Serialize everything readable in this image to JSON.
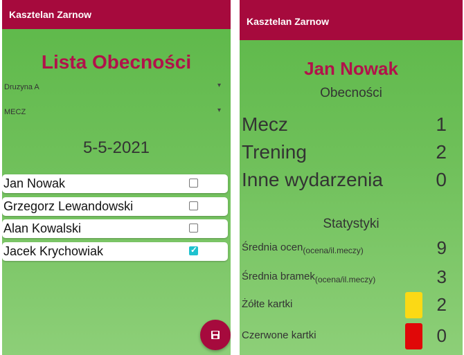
{
  "left_screen": {
    "app_title": "Kasztelan Zarnow",
    "page_title": "Lista Obecności",
    "team_dropdown": "Druzyna A",
    "event_dropdown": "MECZ",
    "date": "5-5-2021",
    "players": [
      {
        "name": "Jan  Nowak",
        "present": false
      },
      {
        "name": "Grzegorz Lewandowski",
        "present": false
      },
      {
        "name": "Alan Kowalski",
        "present": false
      },
      {
        "name": "Jacek Krychowiak",
        "present": true
      }
    ],
    "save_icon": "save-icon"
  },
  "right_screen": {
    "app_title": "Kasztelan Zarnow",
    "player_name": "Jan  Nowak",
    "attendance_heading": "Obecności",
    "attendance": [
      {
        "label": "Mecz",
        "value": "1"
      },
      {
        "label": "Trening",
        "value": "2"
      },
      {
        "label": "Inne wydarzenia",
        "value": "0"
      }
    ],
    "stats_heading": "Statystyki",
    "stats": [
      {
        "label": "Średnia ocen",
        "sub": "(ocena/il.meczy)",
        "value": "9"
      },
      {
        "label": "Średnia bramek",
        "sub": "(ocena/il.meczy)",
        "value": "3"
      },
      {
        "label": "Żółte kartki",
        "value": "2",
        "card_color": "#fbd915"
      },
      {
        "label": "Czerwone kartki",
        "value": "0",
        "card_color": "#e00808"
      }
    ]
  },
  "colors": {
    "appbar": "#a60a3d",
    "title_red": "#b1124a",
    "checkbox_checked": "#1fc2cf",
    "background_green": "#6fc05a"
  }
}
